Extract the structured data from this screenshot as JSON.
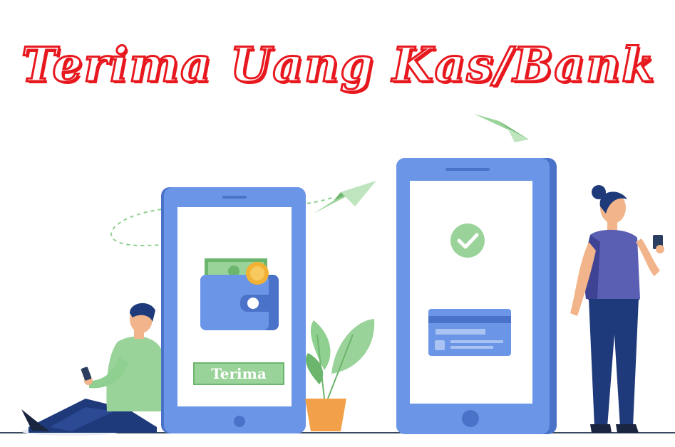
{
  "title": "Terima Uang Kas/Bank",
  "left_phone": {
    "button_label": "Terima"
  },
  "colors": {
    "title_red": "#e8181f",
    "phone_blue": "#6b96e8",
    "phone_blue_dark": "#4a72c9",
    "green": "#8fcf8f",
    "navy": "#1f3a7a"
  },
  "icons": [
    "wallet-icon",
    "coin-icon",
    "check-circle-icon",
    "credit-card-icon",
    "paper-plane-icon"
  ]
}
